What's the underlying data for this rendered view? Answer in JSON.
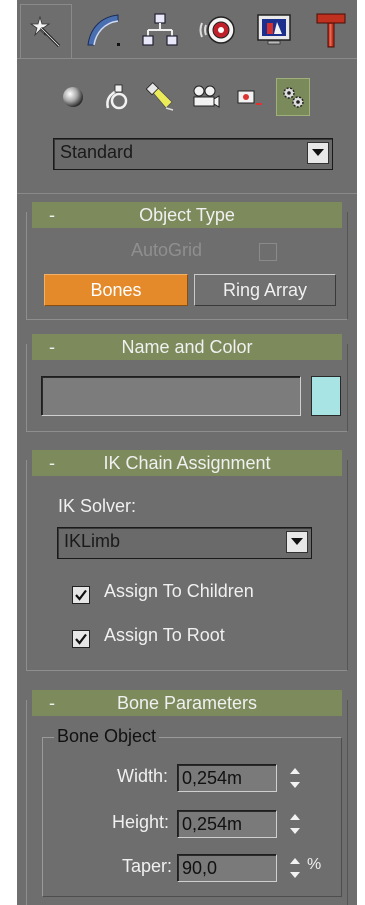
{
  "tabs": [
    {
      "id": "create",
      "icon": "create-star-icon",
      "active": true
    },
    {
      "id": "modify",
      "icon": "modify-curve-icon",
      "active": false
    },
    {
      "id": "hierarchy",
      "icon": "hierarchy-icon",
      "active": false
    },
    {
      "id": "motion",
      "icon": "motion-icon",
      "active": false
    },
    {
      "id": "display",
      "icon": "display-monitor-icon",
      "active": false
    },
    {
      "id": "utilities",
      "icon": "utilities-hammer-icon",
      "active": false
    }
  ],
  "categories": [
    {
      "id": "geometry",
      "icon": "sphere-icon",
      "active": false
    },
    {
      "id": "shapes",
      "icon": "shapes-icon",
      "active": false
    },
    {
      "id": "lights",
      "icon": "light-icon",
      "active": false
    },
    {
      "id": "cameras",
      "icon": "camera-icon",
      "active": false
    },
    {
      "id": "helpers",
      "icon": "helper-icon",
      "active": false
    },
    {
      "id": "systems",
      "icon": "systems-gears-icon",
      "active": true
    }
  ],
  "type_dropdown": {
    "value": "Standard"
  },
  "object_type": {
    "minus": "-",
    "title": "Object Type",
    "autogrid_label": "AutoGrid",
    "bones_label": "Bones",
    "ring_array_label": "Ring Array"
  },
  "name_color": {
    "minus": "-",
    "title": "Name and Color",
    "name_value": "",
    "swatch_color": "#a8e4e4"
  },
  "ik_chain": {
    "minus": "-",
    "title": "IK Chain Assignment",
    "solver_label": "IK Solver:",
    "solver_value": "IKLimb",
    "assign_children_label": "Assign To Children",
    "assign_children_checked": true,
    "assign_root_label": "Assign To Root",
    "assign_root_checked": true
  },
  "bone_params": {
    "minus": "-",
    "title": "Bone Parameters",
    "group_title": "Bone Object",
    "width_label": "Width:",
    "width_value": "0,254m",
    "height_label": "Height:",
    "height_value": "0,254m",
    "taper_label": "Taper:",
    "taper_value": "90,0",
    "taper_unit": "%"
  },
  "colors": {
    "panel_bg": "#6e6e6e",
    "rollout_header": "#7d8b5c",
    "active_button": "#e58a2a",
    "swatch": "#a8e4e4"
  }
}
